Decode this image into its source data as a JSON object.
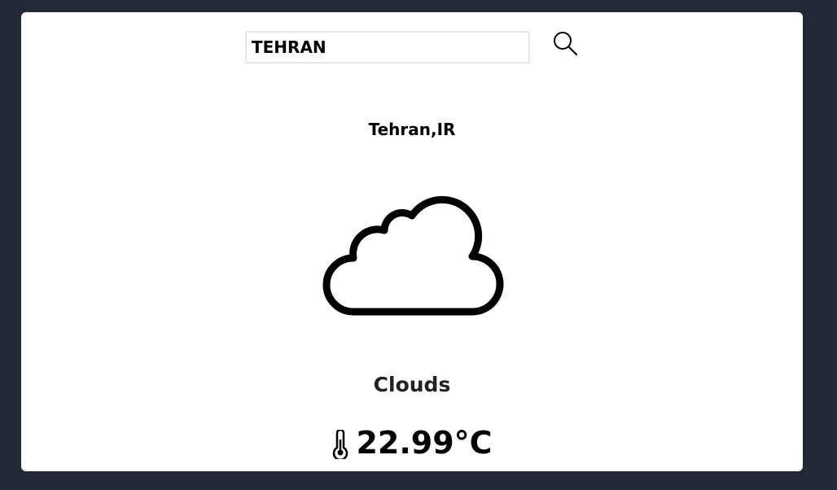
{
  "search": {
    "value": "TEHRAN",
    "icon": "search-icon"
  },
  "location": {
    "name": "Tehran,IR"
  },
  "weather": {
    "icon": "cloud-icon",
    "condition": "Clouds",
    "temperature": "22.99°C",
    "temperature_icon": "thermometer-icon"
  },
  "colors": {
    "background": "#232937",
    "card": "#ffffff",
    "text": "#000000"
  }
}
